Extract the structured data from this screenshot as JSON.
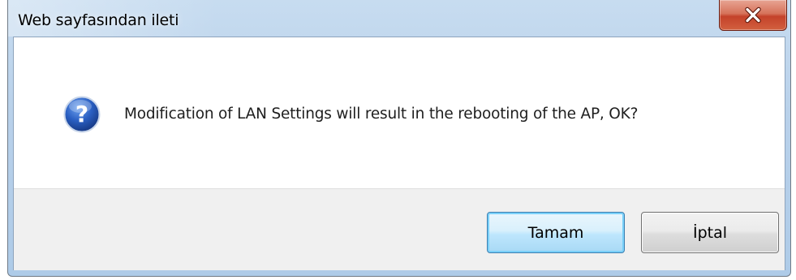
{
  "window": {
    "title": "Web sayfasından ileti"
  },
  "dialog": {
    "icon": "question-icon",
    "message": "Modification of LAN Settings will result in the rebooting of the AP, OK?"
  },
  "buttons": {
    "ok_label": "Tamam",
    "cancel_label": "İptal"
  },
  "colors": {
    "titlebar": "#b9d1ea",
    "close_button": "#c4422a",
    "icon_blue": "#1f4fa8",
    "button_area": "#f0f0f0"
  }
}
